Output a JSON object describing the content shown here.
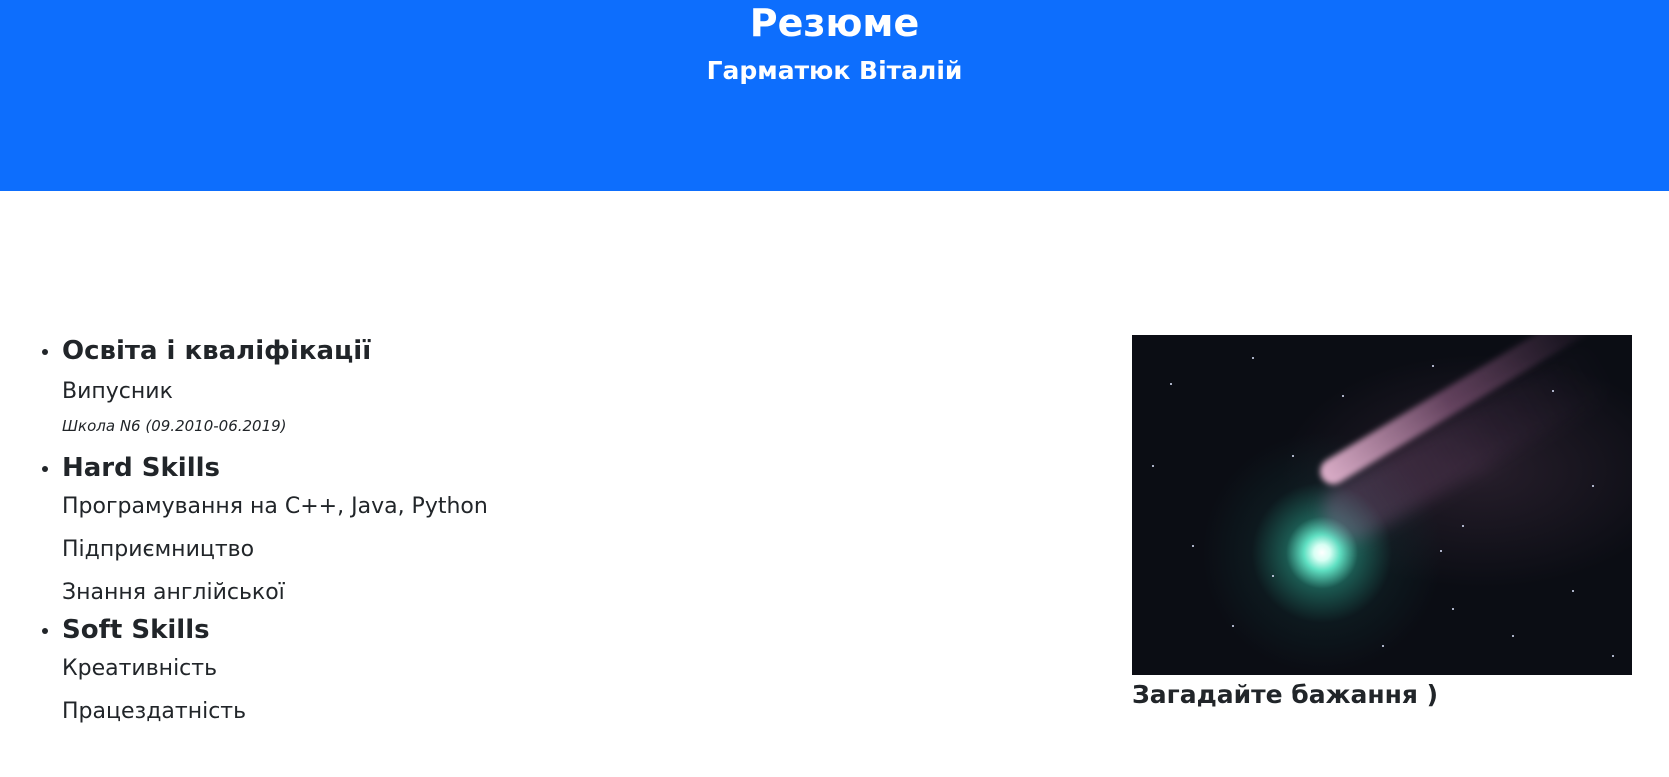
{
  "header": {
    "title": "Резюме",
    "subtitle": "Гарматюк Віталій",
    "background_color": "#0d6efd"
  },
  "sections": {
    "education": {
      "heading": "Освіта і кваліфікації",
      "items": [
        "Випусник"
      ],
      "note": "Школа N6 (09.2010-06.2019)"
    },
    "hard_skills": {
      "heading": "Hard Skills",
      "items": [
        "Програмування на C++, Java, Python",
        "Підприємництво",
        "Знання англійської"
      ]
    },
    "soft_skills": {
      "heading": "Soft Skills",
      "items": [
        "Креативність",
        "Працездатність"
      ]
    }
  },
  "figure": {
    "image": "comet-photo",
    "caption": "Загадайте бажання )"
  }
}
